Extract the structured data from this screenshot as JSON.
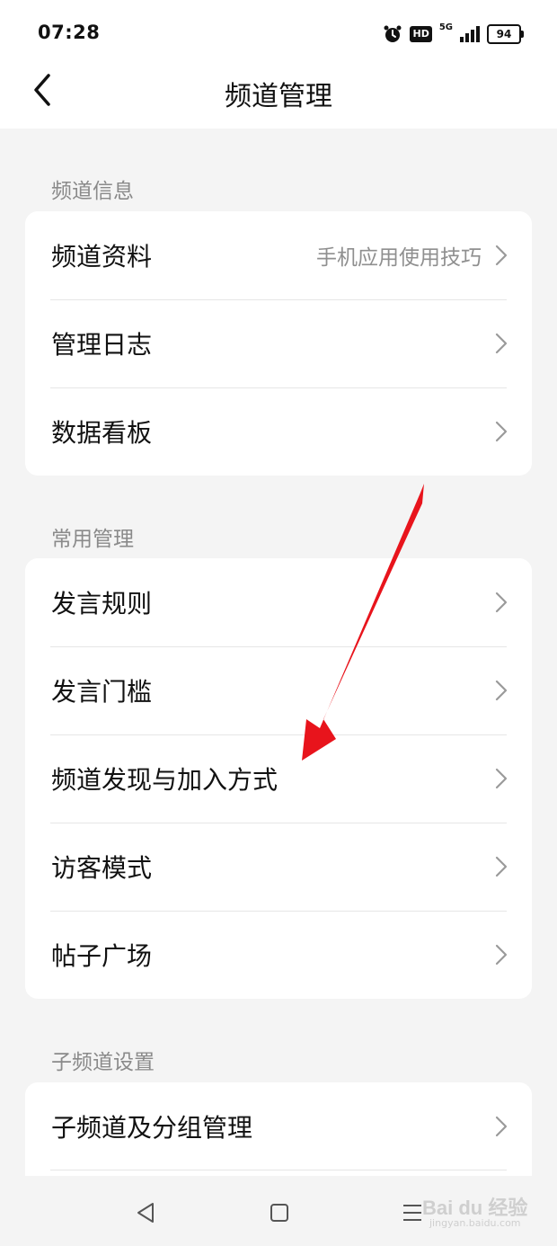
{
  "status_bar": {
    "time": "07:28",
    "hd": "HD",
    "network": "5G",
    "battery": "94"
  },
  "header": {
    "title": "频道管理"
  },
  "sections": [
    {
      "label": "频道信息",
      "items": [
        {
          "label": "频道资料",
          "value": "手机应用使用技巧"
        },
        {
          "label": "管理日志"
        },
        {
          "label": "数据看板"
        }
      ]
    },
    {
      "label": "常用管理",
      "items": [
        {
          "label": "发言规则"
        },
        {
          "label": "发言门槛"
        },
        {
          "label": "频道发现与加入方式"
        },
        {
          "label": "访客模式"
        },
        {
          "label": "帖子广场"
        }
      ]
    },
    {
      "label": "子频道设置",
      "items": [
        {
          "label": "子频道及分组管理"
        }
      ]
    }
  ],
  "watermark": {
    "text": "Bai du 经验",
    "sub": "jingyan.baidu.com"
  },
  "colors": {
    "arrow": "#e8141c",
    "background": "#f4f4f4",
    "card": "#ffffff",
    "secondary_text": "#8a8a8a"
  }
}
